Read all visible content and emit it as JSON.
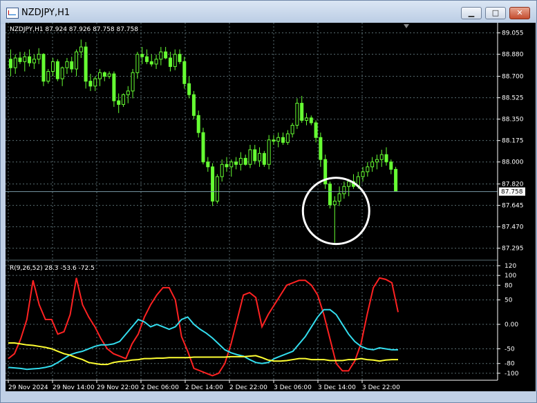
{
  "window": {
    "title": "NZDJPY,H1",
    "controls": {
      "minimize": "▁",
      "maximize": "□",
      "close": "✕"
    }
  },
  "header": {
    "symbol_info": "NZDJPY,H1  87.924 87.926 87.758 87.758"
  },
  "indicator": {
    "label": "R(9,26,52) 28.3 -53.6 -72.5"
  },
  "colors": {
    "background": "#000000",
    "grid": "#5a6e73",
    "candle": "#66ff33",
    "axis_text": "#ffffff",
    "red_line": "#ff2222",
    "cyan_line": "#33ddee",
    "yellow_line": "#ffff33"
  },
  "chart_data": [
    {
      "type": "candlestick",
      "title": "NZDJPY,H1",
      "yticks": [
        "89.055",
        "88.880",
        "88.700",
        "88.525",
        "88.350",
        "88.175",
        "88.000",
        "87.820",
        "87.645",
        "87.470",
        "87.295"
      ],
      "ylim": [
        87.22,
        89.07
      ],
      "current_price": "87.758",
      "candles": [
        [
          88.84,
          88.92,
          88.7,
          88.77
        ],
        [
          88.77,
          88.88,
          88.72,
          88.85
        ],
        [
          88.85,
          88.9,
          88.8,
          88.82
        ],
        [
          88.82,
          88.9,
          88.74,
          88.86
        ],
        [
          88.86,
          88.92,
          88.78,
          88.81
        ],
        [
          88.81,
          88.88,
          88.76,
          88.84
        ],
        [
          88.84,
          88.93,
          88.8,
          88.88
        ],
        [
          88.88,
          88.89,
          88.62,
          88.66
        ],
        [
          88.66,
          88.76,
          88.64,
          88.74
        ],
        [
          88.74,
          88.85,
          88.7,
          88.82
        ],
        [
          88.82,
          88.84,
          88.66,
          88.68
        ],
        [
          88.68,
          88.78,
          88.62,
          88.77
        ],
        [
          88.77,
          88.85,
          88.72,
          88.82
        ],
        [
          88.82,
          88.86,
          88.73,
          88.76
        ],
        [
          88.76,
          88.92,
          88.7,
          88.9
        ],
        [
          88.9,
          89.0,
          88.85,
          88.94
        ],
        [
          88.94,
          88.98,
          88.6,
          88.66
        ],
        [
          88.66,
          88.72,
          88.58,
          88.62
        ],
        [
          88.62,
          88.7,
          88.58,
          88.68
        ],
        [
          88.68,
          88.76,
          88.62,
          88.73
        ],
        [
          88.73,
          88.74,
          88.66,
          88.7
        ],
        [
          88.7,
          88.74,
          88.68,
          88.72
        ],
        [
          88.72,
          88.74,
          88.45,
          88.5
        ],
        [
          88.5,
          88.56,
          88.4,
          88.47
        ],
        [
          88.47,
          88.56,
          88.45,
          88.55
        ],
        [
          88.55,
          88.62,
          88.48,
          88.58
        ],
        [
          88.58,
          88.76,
          88.52,
          88.73
        ],
        [
          88.73,
          88.9,
          88.68,
          88.88
        ],
        [
          88.88,
          88.94,
          88.8,
          88.86
        ],
        [
          88.86,
          88.92,
          88.8,
          88.82
        ],
        [
          88.82,
          88.88,
          88.78,
          88.8
        ],
        [
          88.8,
          88.88,
          88.76,
          88.84
        ],
        [
          88.84,
          88.94,
          88.79,
          88.9
        ],
        [
          88.9,
          88.94,
          88.84,
          88.85
        ],
        [
          88.85,
          88.9,
          88.74,
          88.78
        ],
        [
          88.78,
          88.92,
          88.75,
          88.88
        ],
        [
          88.88,
          88.92,
          88.8,
          88.82
        ],
        [
          88.82,
          88.86,
          88.6,
          88.64
        ],
        [
          88.64,
          88.7,
          88.52,
          88.55
        ],
        [
          88.55,
          88.58,
          88.35,
          88.38
        ],
        [
          88.38,
          88.42,
          88.2,
          88.24
        ],
        [
          88.24,
          88.28,
          87.98,
          88.0
        ],
        [
          88.0,
          88.04,
          87.92,
          87.96
        ],
        [
          87.96,
          87.99,
          87.64,
          87.68
        ],
        [
          87.68,
          87.9,
          87.66,
          87.88
        ],
        [
          87.88,
          88.02,
          87.84,
          87.98
        ],
        [
          87.98,
          88.04,
          87.92,
          87.96
        ],
        [
          87.96,
          88.02,
          87.88,
          88.0
        ],
        [
          88.0,
          88.04,
          87.94,
          87.98
        ],
        [
          87.98,
          88.08,
          87.93,
          88.03
        ],
        [
          88.03,
          88.06,
          87.97,
          87.98
        ],
        [
          87.98,
          88.14,
          87.95,
          88.1
        ],
        [
          88.1,
          88.14,
          87.98,
          88.01
        ],
        [
          88.01,
          88.12,
          87.96,
          88.07
        ],
        [
          88.07,
          88.09,
          87.96,
          87.98
        ],
        [
          87.98,
          88.22,
          87.94,
          88.18
        ],
        [
          88.18,
          88.22,
          88.14,
          88.17
        ],
        [
          88.17,
          88.24,
          88.12,
          88.2
        ],
        [
          88.2,
          88.24,
          88.14,
          88.16
        ],
        [
          88.16,
          88.26,
          88.14,
          88.23
        ],
        [
          88.23,
          88.32,
          88.2,
          88.3
        ],
        [
          88.3,
          88.52,
          88.27,
          88.48
        ],
        [
          88.48,
          88.54,
          88.32,
          88.34
        ],
        [
          88.34,
          88.4,
          88.3,
          88.36
        ],
        [
          88.36,
          88.38,
          88.3,
          88.32
        ],
        [
          88.32,
          88.34,
          88.16,
          88.2
        ],
        [
          88.2,
          88.24,
          87.96,
          88.02
        ],
        [
          88.02,
          88.06,
          87.78,
          87.82
        ],
        [
          87.82,
          87.84,
          87.62,
          87.65
        ],
        [
          87.65,
          87.72,
          87.34,
          87.68
        ],
        [
          87.68,
          87.8,
          87.64,
          87.74
        ],
        [
          87.74,
          87.84,
          87.7,
          87.8
        ],
        [
          87.8,
          87.86,
          87.72,
          87.84
        ],
        [
          87.84,
          87.9,
          87.78,
          87.8
        ],
        [
          87.8,
          87.92,
          87.78,
          87.88
        ],
        [
          87.88,
          87.96,
          87.84,
          87.92
        ],
        [
          87.92,
          88.0,
          87.88,
          87.96
        ],
        [
          87.96,
          88.04,
          87.92,
          88.0
        ],
        [
          88.0,
          88.06,
          87.94,
          88.02
        ],
        [
          88.02,
          88.1,
          87.96,
          88.06
        ],
        [
          88.06,
          88.12,
          87.97,
          88.0
        ],
        [
          88.0,
          88.02,
          87.9,
          87.94
        ],
        [
          87.94,
          87.96,
          87.76,
          87.76
        ]
      ],
      "x_tick_labels": [
        "29 Nov 2024",
        "29 Nov 14:00",
        "29 Nov 22:00",
        "2 Dec 06:00",
        "2 Dec 14:00",
        "2 Dec 22:00",
        "3 Dec 06:00",
        "3 Dec 14:00",
        "3 Dec 22:00"
      ],
      "annotation": "circle around low"
    },
    {
      "type": "line",
      "title": "R(9,26,52) 28.3 -53.6 -72.5",
      "yticks": [
        "120",
        "100",
        "80",
        "50",
        "0.00",
        "-50",
        "-80",
        "-100"
      ],
      "ylim": [
        -110,
        120
      ],
      "series": [
        {
          "color": "#ff2222",
          "values": [
            -70,
            -60,
            -30,
            10,
            90,
            40,
            10,
            10,
            -20,
            -15,
            20,
            95,
            40,
            15,
            -5,
            -30,
            -50,
            -60,
            -65,
            -70,
            -40,
            -20,
            15,
            40,
            60,
            75,
            75,
            50,
            -25,
            -55,
            -90,
            -95,
            -100,
            -105,
            -100,
            -80,
            -40,
            10,
            60,
            65,
            55,
            -5,
            20,
            40,
            60,
            80,
            85,
            90,
            90,
            80,
            60,
            20,
            -30,
            -80,
            -95,
            -95,
            -75,
            -40,
            20,
            75,
            95,
            92,
            85,
            25
          ]
        },
        {
          "color": "#33ddee",
          "values": [
            -88,
            -89,
            -90,
            -92,
            -91,
            -90,
            -88,
            -85,
            -78,
            -70,
            -62,
            -58,
            -55,
            -50,
            -45,
            -42,
            -42,
            -40,
            -35,
            -20,
            -5,
            10,
            5,
            -5,
            0,
            -5,
            -10,
            -5,
            10,
            15,
            0,
            -10,
            -18,
            -28,
            -40,
            -52,
            -58,
            -62,
            -65,
            -72,
            -78,
            -80,
            -78,
            -70,
            -65,
            -60,
            -55,
            -40,
            -25,
            -5,
            15,
            30,
            30,
            20,
            0,
            -20,
            -35,
            -45,
            -50,
            -52,
            -48,
            -50,
            -52,
            -52
          ]
        },
        {
          "color": "#ffff33",
          "values": [
            -38,
            -38,
            -40,
            -42,
            -43,
            -45,
            -47,
            -50,
            -55,
            -60,
            -63,
            -68,
            -72,
            -78,
            -80,
            -82,
            -82,
            -78,
            -76,
            -75,
            -73,
            -72,
            -70,
            -70,
            -69,
            -69,
            -68,
            -68,
            -68,
            -68,
            -67,
            -67,
            -67,
            -67,
            -67,
            -67,
            -66,
            -66,
            -66,
            -65,
            -64,
            -68,
            -73,
            -75,
            -75,
            -74,
            -72,
            -70,
            -70,
            -72,
            -72,
            -72,
            -74,
            -74,
            -74,
            -72,
            -72,
            -70,
            -72,
            -73,
            -75,
            -73,
            -72,
            -72
          ]
        }
      ]
    }
  ]
}
